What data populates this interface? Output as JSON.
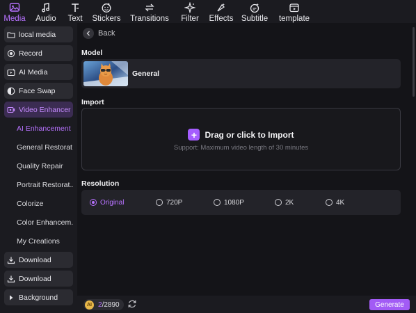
{
  "toolbar": {
    "tabs": [
      {
        "label": "Media",
        "icon": "media-icon"
      },
      {
        "label": "Audio",
        "icon": "music-note-icon"
      },
      {
        "label": "Text",
        "icon": "text-icon"
      },
      {
        "label": "Stickers",
        "icon": "sticker-icon"
      },
      {
        "label": "Transitions",
        "icon": "transitions-icon"
      },
      {
        "label": "Filter",
        "icon": "sparkle-icon"
      },
      {
        "label": "Effects",
        "icon": "effects-icon"
      },
      {
        "label": "Subtitle",
        "icon": "subtitle-icon"
      },
      {
        "label": "template",
        "icon": "template-icon"
      }
    ],
    "active_tab": "Media"
  },
  "sidebar": {
    "items": [
      {
        "label": "local media",
        "icon": "folder-icon"
      },
      {
        "label": "Record",
        "icon": "record-icon"
      },
      {
        "label": "AI Media",
        "icon": "ai-media-icon"
      },
      {
        "label": "Face Swap",
        "icon": "face-swap-icon"
      },
      {
        "label": "Video Enhancer",
        "icon": "video-enhancer-icon"
      }
    ],
    "sub_items": [
      {
        "label": "AI Enhancement"
      },
      {
        "label": "General Restorat..."
      },
      {
        "label": "Quality Repair"
      },
      {
        "label": "Portrait Restorat..."
      },
      {
        "label": "Colorize"
      },
      {
        "label": "Color Enhancem..."
      },
      {
        "label": "My Creations"
      }
    ],
    "bottom_items": [
      {
        "label": "Download",
        "icon": "download-icon"
      },
      {
        "label": "Download",
        "icon": "download-icon"
      },
      {
        "label": "Background",
        "icon": "caret-right-icon"
      }
    ]
  },
  "main": {
    "back_label": "Back",
    "model_title": "Model",
    "model_name": "General",
    "import_title": "Import",
    "import_text": "Drag or click to Import",
    "import_support": "Support: Maximum video length of 30 minutes",
    "resolution_title": "Resolution",
    "resolutions": [
      "Original",
      "720P",
      "1080P",
      "2K",
      "4K"
    ],
    "selected_resolution": "Original"
  },
  "bottom": {
    "credits_used": "2",
    "credits_total": "/2890",
    "coin_label": "AI",
    "generate_label": "Generate"
  },
  "colors": {
    "accent": "#b772ff",
    "generate_button": "#a25bf5",
    "background": "#141418",
    "panel": "#1b1b20"
  }
}
